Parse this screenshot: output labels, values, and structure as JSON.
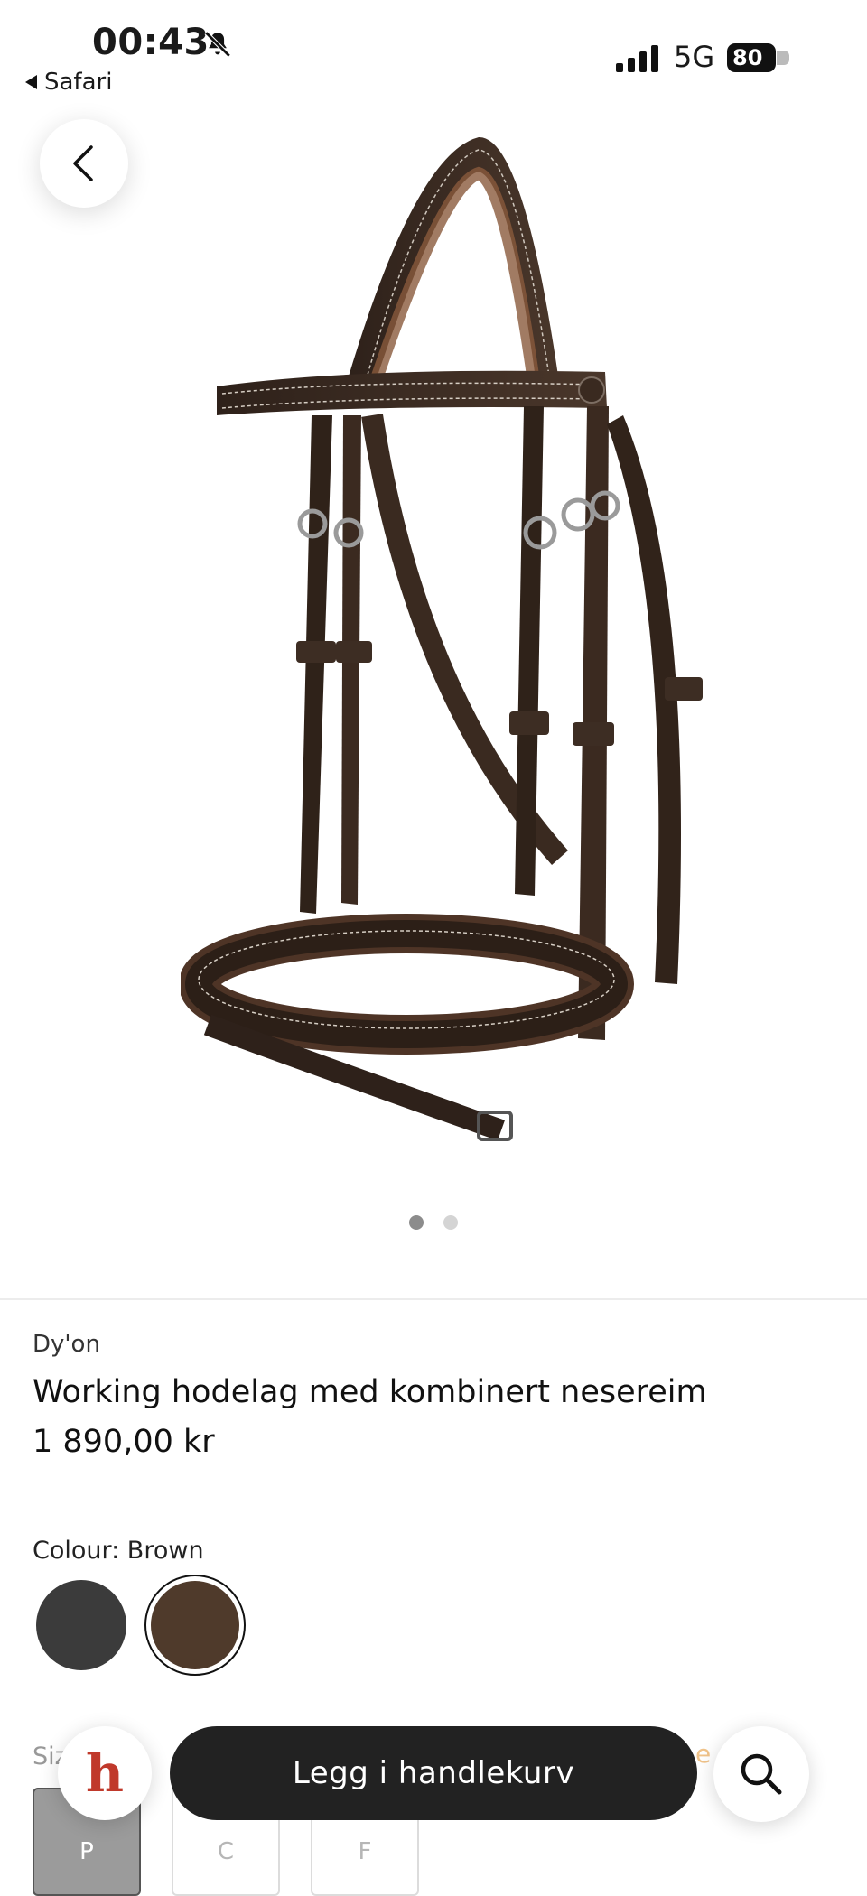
{
  "status_bar": {
    "time": "00:43",
    "back_app": "Safari",
    "network": "5G",
    "battery": "80"
  },
  "icons": {
    "back": "chevron-left-icon",
    "bell": "bell-slash-icon",
    "logo": "h-logo-icon",
    "search": "search-icon"
  },
  "product": {
    "brand": "Dy'on",
    "title": "Working hodelag med kombinert nesereim",
    "price": "1 890,00 kr",
    "colour_label": "Colour: Brown",
    "colours": [
      {
        "name": "Black",
        "hex": "#3b3b3b"
      },
      {
        "name": "Brown",
        "hex": "#4f3a2b",
        "selected": true
      }
    ],
    "image_count": 2,
    "image_active": 1
  },
  "size": {
    "label": "Siz",
    "guide": "e guider",
    "options": [
      "P",
      "C",
      "F"
    ]
  },
  "actions": {
    "logo_letter": "h",
    "add_to_cart": "Legg i handlekurv"
  }
}
